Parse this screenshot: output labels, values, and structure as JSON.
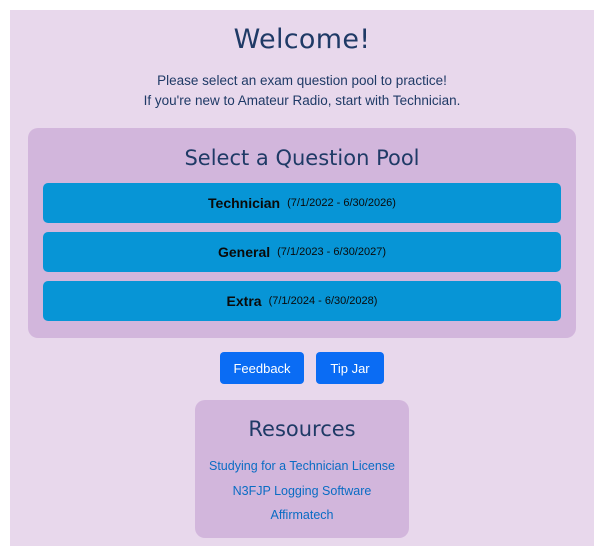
{
  "header": {
    "title": "Welcome!",
    "intro_line1": "Please select an exam question pool to practice!",
    "intro_line2": "If you're new to Amateur Radio, start with Technician."
  },
  "pool_section": {
    "heading": "Select a Question Pool",
    "pools": [
      {
        "name": "Technician",
        "dates": "(7/1/2022 - 6/30/2026)"
      },
      {
        "name": "General",
        "dates": "(7/1/2023 - 6/30/2027)"
      },
      {
        "name": "Extra",
        "dates": "(7/1/2024 - 6/30/2028)"
      }
    ]
  },
  "actions": {
    "feedback_label": "Feedback",
    "tip_jar_label": "Tip Jar"
  },
  "resources": {
    "heading": "Resources",
    "links": [
      "Studying for a Technician License",
      "N3FJP Logging Software",
      "Affirmatech"
    ]
  },
  "colors": {
    "page_background": "#e8d8ec",
    "panel_background": "#d2b6dc",
    "pool_button": "#0795d6",
    "action_button": "#0a6cf4",
    "heading_text": "#1f3a66",
    "link_text": "#0a6cc4"
  }
}
